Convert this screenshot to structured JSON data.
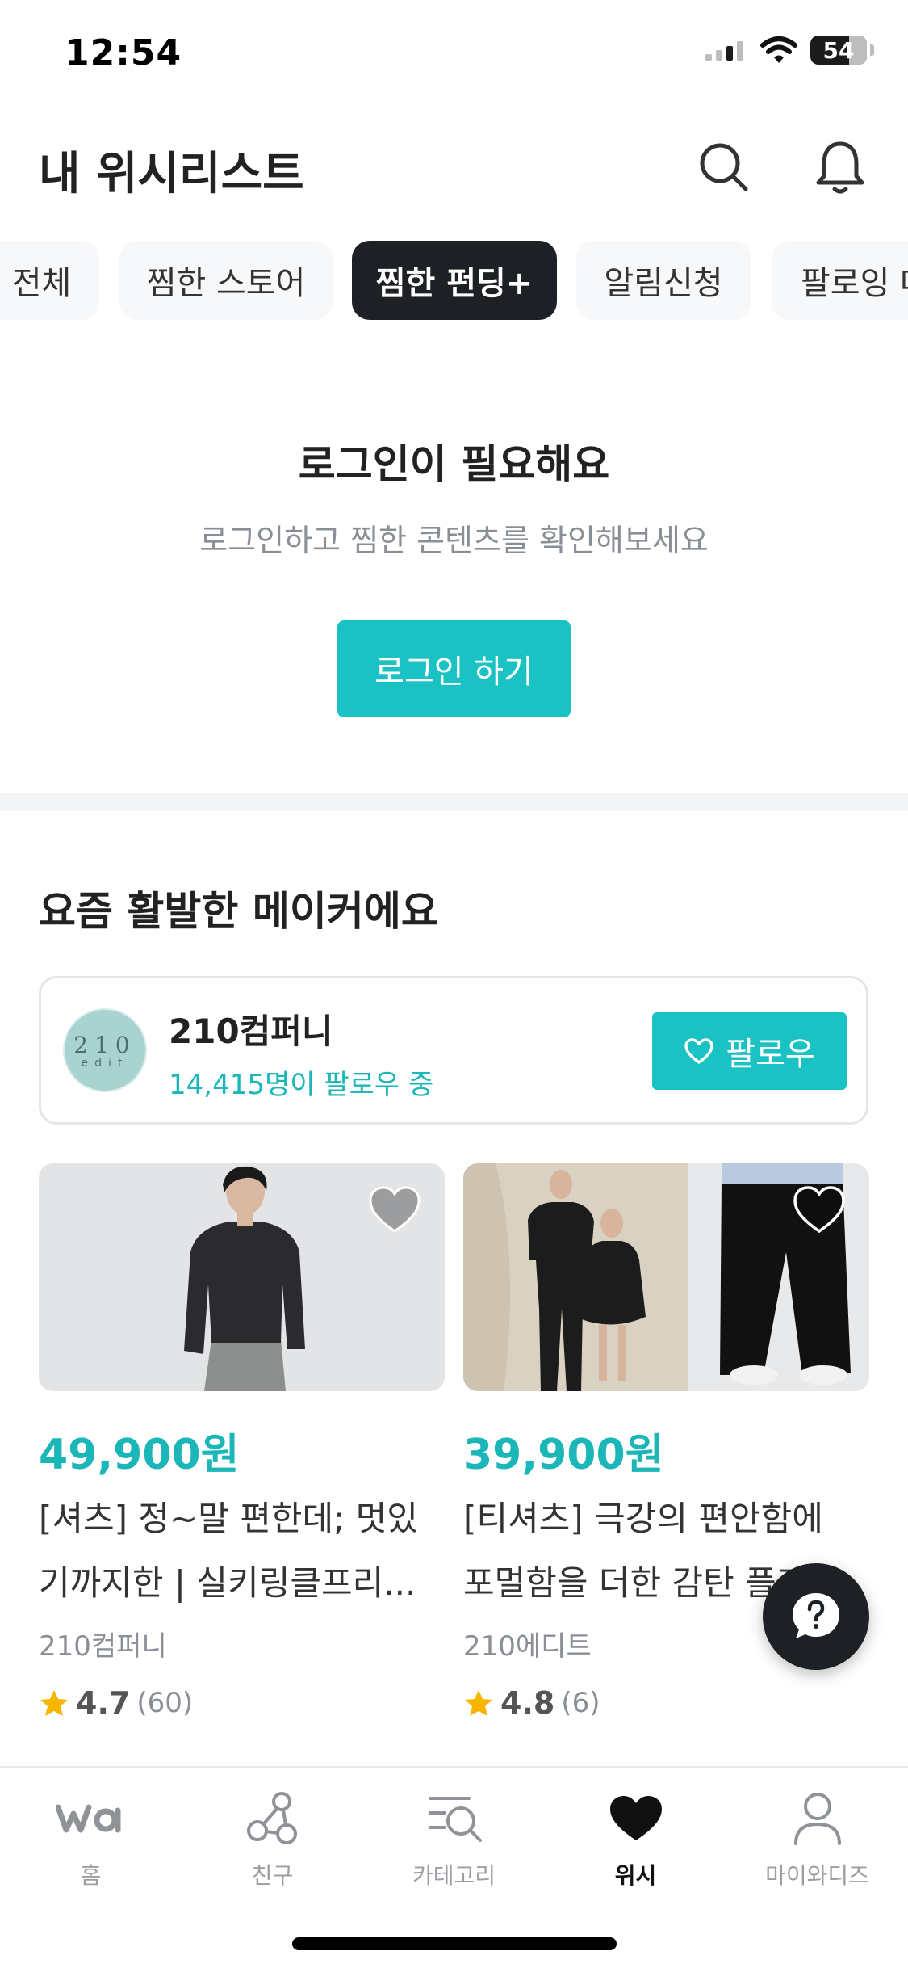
{
  "status_bar": {
    "time": "12:54",
    "battery": "54"
  },
  "header": {
    "title": "내 위시리스트"
  },
  "tabs": [
    {
      "label": "전체",
      "active": false
    },
    {
      "label": "찜한 스토어",
      "active": false
    },
    {
      "label": "찜한 펀딩+",
      "active": true
    },
    {
      "label": "알림신청",
      "active": false
    },
    {
      "label": "팔로잉 메",
      "active": false
    }
  ],
  "login_prompt": {
    "title": "로그인이 필요해요",
    "subtitle": "로그인하고 찜한 콘텐츠를 확인해보세요",
    "button": "로그인 하기"
  },
  "makers_section": {
    "title": "요즘 활발한 메이커에요",
    "maker": {
      "name": "210컴퍼니",
      "followers": "14,415명이 팔로우 중",
      "follow_button": "팔로우",
      "avatar_text": "210",
      "avatar_subtext": "edit"
    }
  },
  "products": [
    {
      "price": "49,900원",
      "title_line1": "[셔츠] 정~말 편한데; 멋있",
      "title_line2": "기까지한 | 실키링클프리...",
      "maker": "210컴퍼니",
      "rating": "4.7",
      "review_count": "(60)"
    },
    {
      "price": "39,900원",
      "title_line1": "[티셔츠] 극강의 편안함에",
      "title_line2": "포멀함을 더한 감탄 플리",
      "maker": "210에디트",
      "rating": "4.8",
      "review_count": "(6)"
    }
  ],
  "bottom_nav": [
    {
      "label": "홈",
      "icon": "wa-logo-icon",
      "active": false
    },
    {
      "label": "친구",
      "icon": "friends-network-icon",
      "active": false
    },
    {
      "label": "카테고리",
      "icon": "category-search-icon",
      "active": false
    },
    {
      "label": "위시",
      "icon": "heart-icon",
      "active": true
    },
    {
      "label": "마이와디즈",
      "icon": "person-icon",
      "active": false
    }
  ],
  "colors": {
    "accent": "#1bc2c3",
    "dark": "#1d2024",
    "muted": "#8a8f96",
    "star": "#f7b500"
  }
}
